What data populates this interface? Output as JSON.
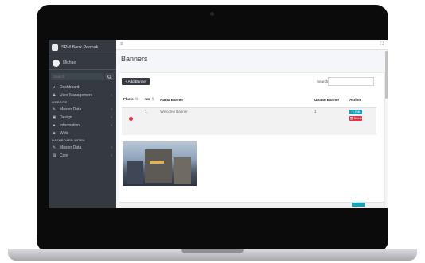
{
  "sidebar": {
    "brand": "SPM Bank Permak",
    "user_name": "Michael",
    "search_placeholder": "Search",
    "items": [
      {
        "label": "Dashboard",
        "icon": "dashboard-icon",
        "has_arrow": false
      },
      {
        "label": "User Management",
        "icon": "user-icon",
        "has_arrow": true
      }
    ],
    "header1": "WEBSITE",
    "items2": [
      {
        "label": "Master Data",
        "icon": "pen-icon",
        "has_arrow": true
      },
      {
        "label": "Design",
        "icon": "image-icon",
        "has_arrow": true
      },
      {
        "label": "Information",
        "icon": "info-icon",
        "has_arrow": true
      },
      {
        "label": "Web",
        "icon": "web-icon",
        "has_arrow": false
      }
    ],
    "header2": "DASHBOARD MITRA",
    "items3": [
      {
        "label": "Master Data",
        "icon": "pen-icon",
        "has_arrow": true
      },
      {
        "label": "Core",
        "icon": "core-icon",
        "has_arrow": true
      }
    ]
  },
  "topbar": {
    "menu_icon": "≡",
    "right_icon": "⛶"
  },
  "page_title": "Banners",
  "card": {
    "add_button": "+ Add Banner",
    "search_label": "Search:",
    "columns": [
      "Photo",
      "No",
      "Nama Banner",
      "Urutan Banner",
      "Action"
    ],
    "rows": [
      {
        "no": "1",
        "name": "Welcome Banner",
        "order": "1",
        "edit": "✎ Edit",
        "delete": "🗑 Delete"
      }
    ]
  },
  "colors": {
    "sidebar": "#343a40",
    "accent_info": "#17a2b8",
    "accent_danger": "#dc3545"
  }
}
